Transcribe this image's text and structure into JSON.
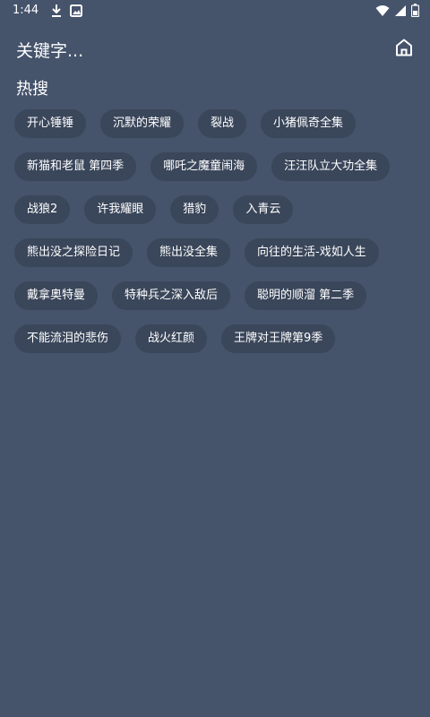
{
  "status_bar": {
    "time": "1:44",
    "left_icons": [
      "download-icon",
      "image-notification-icon"
    ],
    "right_icons": [
      "wifi-icon",
      "cell-signal-icon",
      "battery-icon"
    ]
  },
  "header": {
    "search_keyword": "关键字...",
    "home_icon": "home-icon"
  },
  "hot_search": {
    "title": "热搜",
    "tags": [
      "开心锤锤",
      "沉默的荣耀",
      "裂战",
      "小猪佩奇全集",
      "新猫和老鼠 第四季",
      "哪吒之魔童闹海",
      "汪汪队立大功全集",
      "战狼2",
      "许我耀眼",
      "猎豹",
      "入青云",
      "熊出没之探险日记",
      "熊出没全集",
      "向往的生活-戏如人生",
      "戴拿奥特曼",
      "特种兵之深入敌后",
      "聪明的顺溜 第二季",
      "不能流泪的悲伤",
      "战火红颜",
      "王牌对王牌第9季"
    ]
  },
  "colors": {
    "background": "#45536b",
    "tag_background": "#3a465a",
    "text": "#ffffff"
  }
}
